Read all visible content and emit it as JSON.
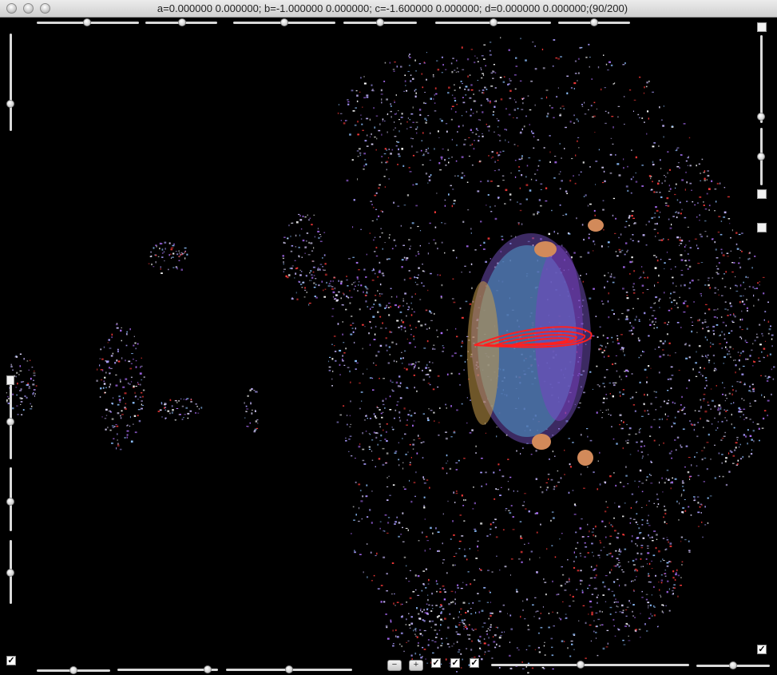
{
  "window": {
    "title": "a=0.000000 0.000000; b=-1.000000 0.000000; c=-1.600000 0.000000; d=0.000000 0.000000;(90/200)"
  },
  "controls": {
    "minus_label": "−",
    "plus_label": "+",
    "check_mark": "✓"
  },
  "colors": {
    "background": "#000000",
    "attractor_red": "#ff2020",
    "blob_blue": "#4a7fb0",
    "blob_purple": "#7a3fc4",
    "blob_orange": "#d28a5a",
    "speckle_lavender": "#c8b8ff"
  }
}
